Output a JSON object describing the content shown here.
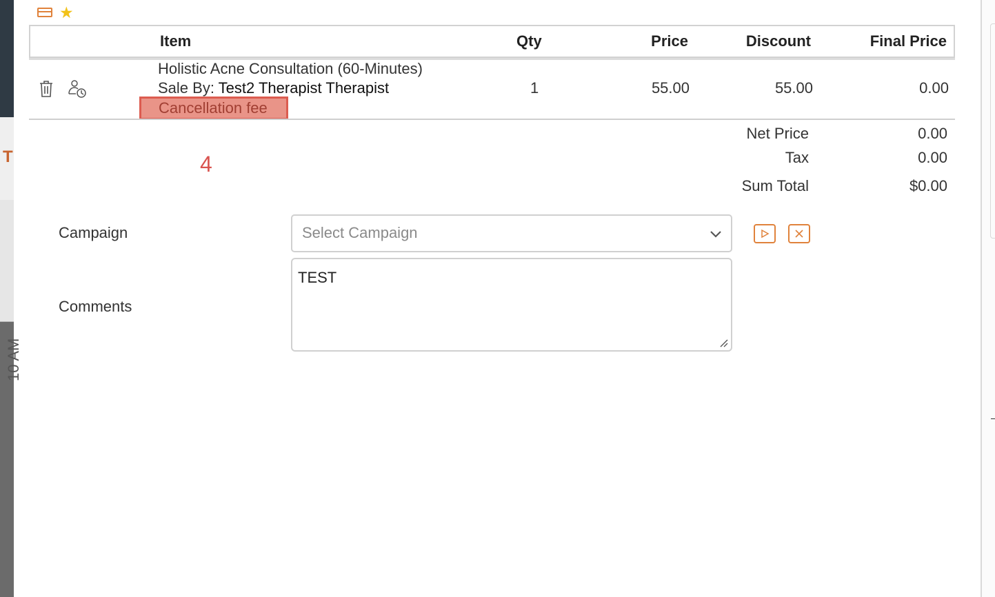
{
  "background": {
    "left_edge_letter": "T",
    "left_edge_vertical_text": "10 AM"
  },
  "table": {
    "headers": {
      "item": "Item",
      "qty": "Qty",
      "price": "Price",
      "discount": "Discount",
      "final_price": "Final Price"
    },
    "rows": [
      {
        "item_name": "Holistic Acne Consultation (60-Minutes)",
        "sale_by_label": "Sale By:",
        "sale_by_name": "Test2 Therapist Therapist",
        "tag": "Cancellation fee",
        "qty": "1",
        "price": "55.00",
        "discount": "55.00",
        "final_price": "0.00"
      }
    ]
  },
  "annotation": {
    "marker": "4"
  },
  "totals": {
    "net_price_label": "Net Price",
    "net_price": "0.00",
    "tax_label": "Tax",
    "tax": "0.00",
    "sum_total_label": "Sum Total",
    "sum_total": "$0.00"
  },
  "form": {
    "campaign_label": "Campaign",
    "campaign_placeholder": "Select Campaign",
    "comments_label": "Comments",
    "comments_value": "TEST"
  },
  "icons": [
    "card-icon",
    "star-icon",
    "trash-icon",
    "assign-therapist-icon",
    "chevron-down-icon",
    "play-icon",
    "close-icon"
  ],
  "colors": {
    "accent": "#e0823b",
    "star": "#f2c21a",
    "highlight_fill": "#e99488",
    "highlight_border": "#dc5c50",
    "annotation": "#d9534f"
  }
}
